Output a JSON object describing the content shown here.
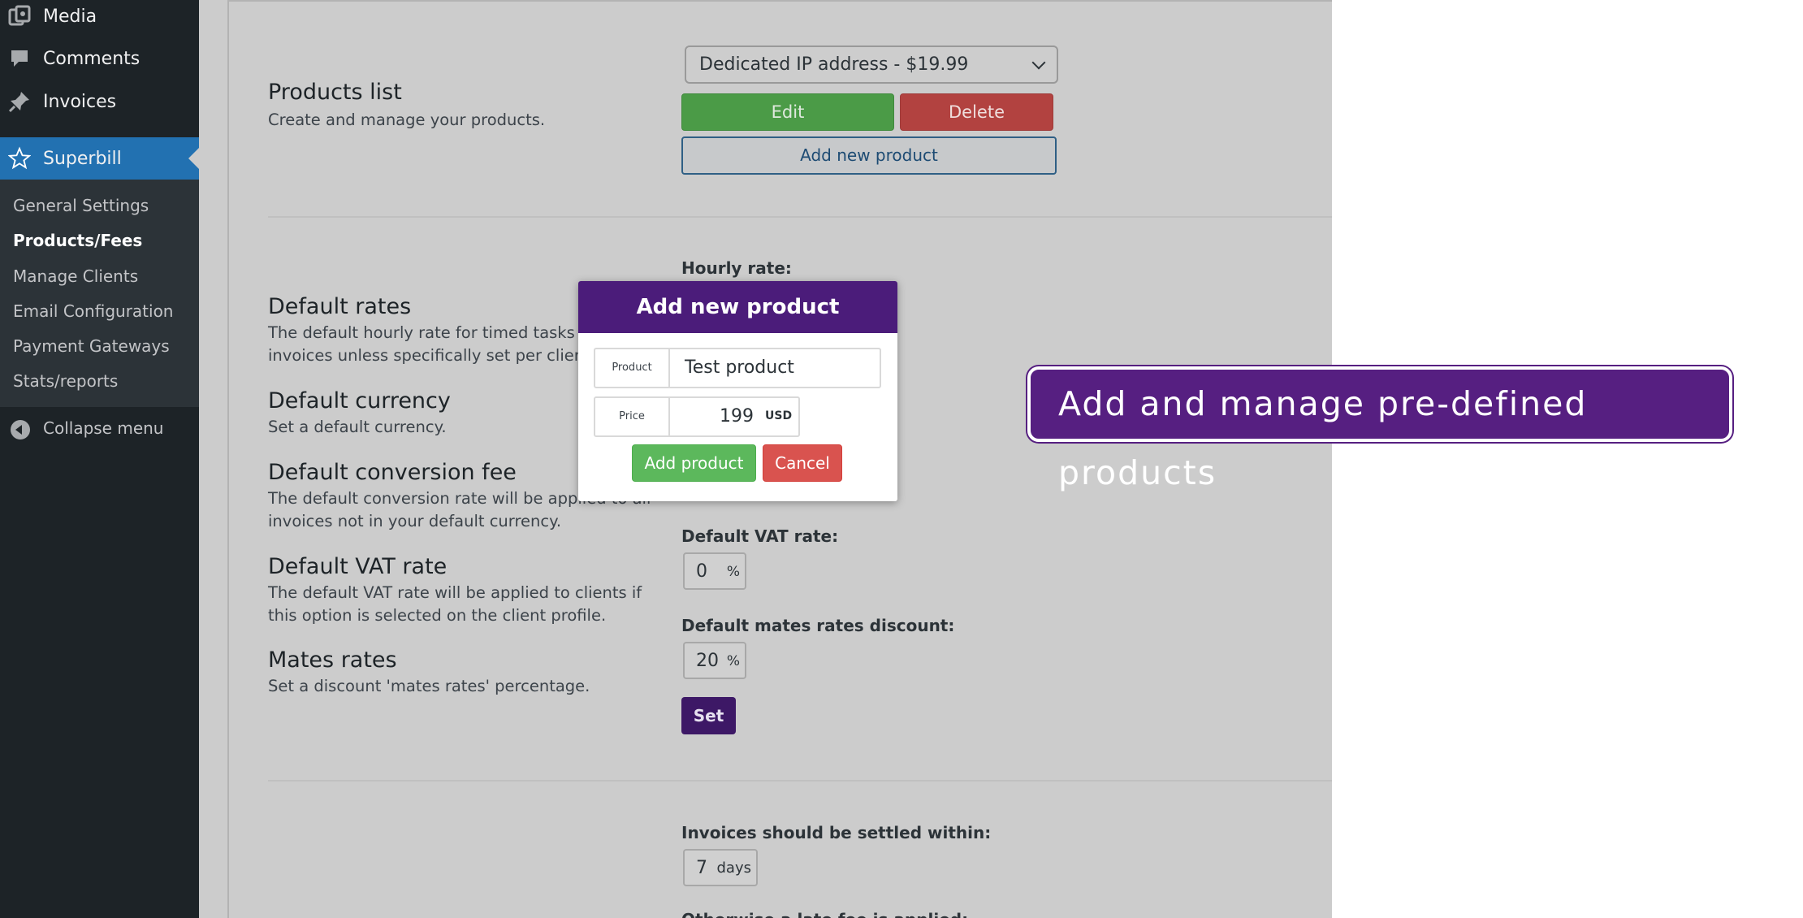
{
  "sidebar": {
    "menu": [
      {
        "label": "Media",
        "icon": "media-icon"
      },
      {
        "label": "Comments",
        "icon": "comment-icon"
      },
      {
        "label": "Invoices",
        "icon": "pin-icon"
      },
      {
        "label": "Superbill",
        "icon": "star-icon"
      }
    ],
    "submenu": [
      {
        "label": "General Settings"
      },
      {
        "label": "Products/Fees"
      },
      {
        "label": "Manage Clients"
      },
      {
        "label": "Email Configuration"
      },
      {
        "label": "Payment Gateways"
      },
      {
        "label": "Stats/reports"
      }
    ],
    "collapse_label": "Collapse menu"
  },
  "products": {
    "heading": "Products list",
    "desc": "Create and manage your products.",
    "selected": "Dedicated IP address - $19.99",
    "edit_label": "Edit",
    "delete_label": "Delete",
    "add_new_label": "Add new product"
  },
  "rates": {
    "hourly_label": "Hourly rate:",
    "default_rates_heading": "Default rates",
    "default_rates_desc1": "The default hourly rate for timed tasks or",
    "default_rates_desc2": "invoices unless specifically set per client.",
    "currency_heading": "Default currency",
    "currency_desc": "Set a default currency.",
    "conversion_heading": "Default conversion fee",
    "conversion_desc1": "The default conversion rate will be applied to all",
    "conversion_desc2": "invoices not in your default currency.",
    "vat_heading": "Default VAT rate",
    "vat_desc1": "The default VAT rate will be applied to clients if",
    "vat_desc2": "this option is selected on the client profile.",
    "mates_heading": "Mates rates",
    "mates_desc": "Set a discount 'mates rates' percentage.",
    "vat_label": "Default VAT rate:",
    "vat_value": "0",
    "vat_unit": "%",
    "mates_label": "Default mates rates discount:",
    "mates_value": "20",
    "mates_unit": "%",
    "set_label": "Set"
  },
  "invoices": {
    "settle_label": "Invoices should be settled within:",
    "settle_value": "7",
    "settle_unit": "days",
    "late_fee_label": "Otherwise a late fee is applied:"
  },
  "modal": {
    "title": "Add new product",
    "product_label": "Product",
    "product_value": "Test product",
    "price_label": "Price",
    "price_value": "199",
    "price_unit": "USD",
    "add_label": "Add product",
    "cancel_label": "Cancel"
  },
  "banner": {
    "text": "Add and manage pre-defined products"
  }
}
